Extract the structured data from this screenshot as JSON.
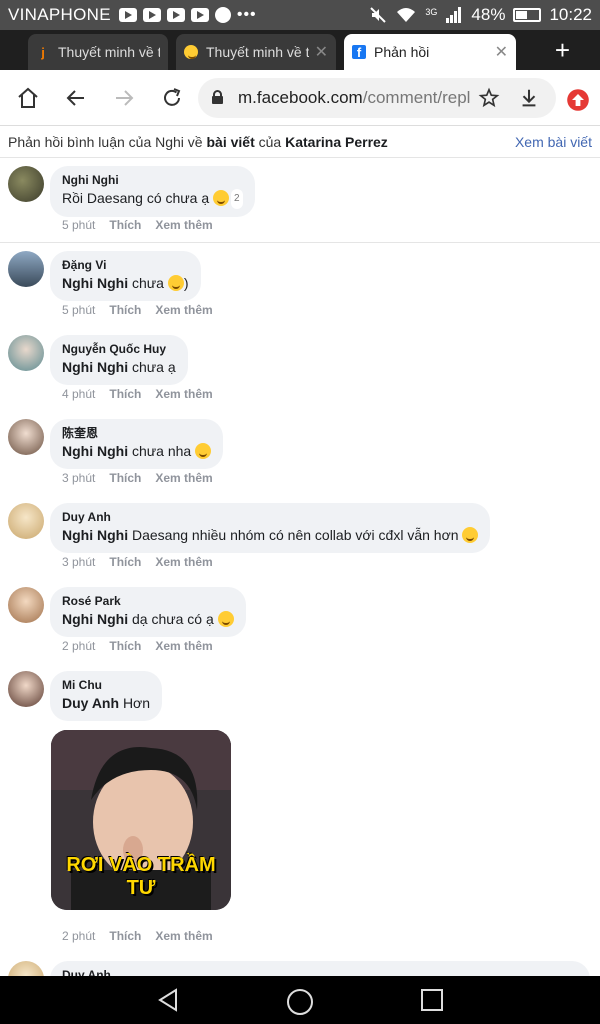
{
  "status_bar": {
    "carrier": "VINAPHONE",
    "network": "3G",
    "battery": "48%",
    "battery_level": 0.48,
    "time": "10:22",
    "notification_icons": [
      "youtube-icon",
      "youtube-icon",
      "youtube-icon",
      "youtube-icon",
      "spotify-icon",
      "more-dots-icon"
    ]
  },
  "tabs": [
    {
      "title": "Thuyết minh về th",
      "icon": "j-app-icon",
      "active": false
    },
    {
      "title": "Thuyết minh về th",
      "icon": "emoji-icon",
      "active": false
    },
    {
      "title": "Phản hồi",
      "icon": "facebook-icon",
      "active": true
    }
  ],
  "toolbar": {
    "url_host": "m.facebook.com",
    "url_path": "/comment/repli"
  },
  "breadcrumb": {
    "prefix": "Phản hồi bình luận của Nghi về",
    "post_link": "bài viết",
    "of": "của",
    "author": "Katarina Perrez",
    "view_post": "Xem bài viết"
  },
  "comments": [
    {
      "author": "Nghi Nghi",
      "mention": "",
      "text": "Rồi Daesang có chưa ạ",
      "emoji": "laughing-emoji",
      "reaction_count": "2",
      "time": "5 phút",
      "like": "Thích",
      "more": "Xem thêm"
    },
    {
      "author": "Đặng Vi",
      "mention": "Nghi Nghi",
      "text": "chưa",
      "emoji": "smile-emoji",
      "suffix": ")",
      "time": "5 phút",
      "like": "Thích",
      "more": "Xem thêm"
    },
    {
      "author": "Nguyễn Quốc Huy",
      "mention": "Nghi Nghi",
      "text": "chưa ạ",
      "time": "4 phút",
      "like": "Thích",
      "more": "Xem thêm"
    },
    {
      "author": "陈奎恩",
      "mention": "Nghi Nghi",
      "text": "chưa nha",
      "emoji": "smile-emoji",
      "time": "3 phút",
      "like": "Thích",
      "more": "Xem thêm"
    },
    {
      "author": "Duy Anh",
      "mention": "Nghi Nghi",
      "text": "Daesang nhiều nhóm có nên collab với cđxl vẫn hơn",
      "emoji": "smile-emoji",
      "time": "3 phút",
      "like": "Thích",
      "more": "Xem thêm"
    },
    {
      "author": "Rosé Park",
      "mention": "Nghi Nghi",
      "text": "dạ chưa có ạ",
      "emoji": "sad-emoji",
      "time": "2 phút",
      "like": "Thích",
      "more": "Xem thêm"
    },
    {
      "author": "Mi Chu",
      "mention": "Duy Anh",
      "text": "Hơn",
      "sticker_caption": "RƠI VÀO TRẦM TƯ",
      "time": "2 phút",
      "like": "Thích",
      "more": "Xem thêm"
    },
    {
      "author": "Duy Anh",
      "mention": "",
      "text": ""
    }
  ],
  "nav_bar": [
    "back-icon",
    "home-icon",
    "recents-icon"
  ]
}
